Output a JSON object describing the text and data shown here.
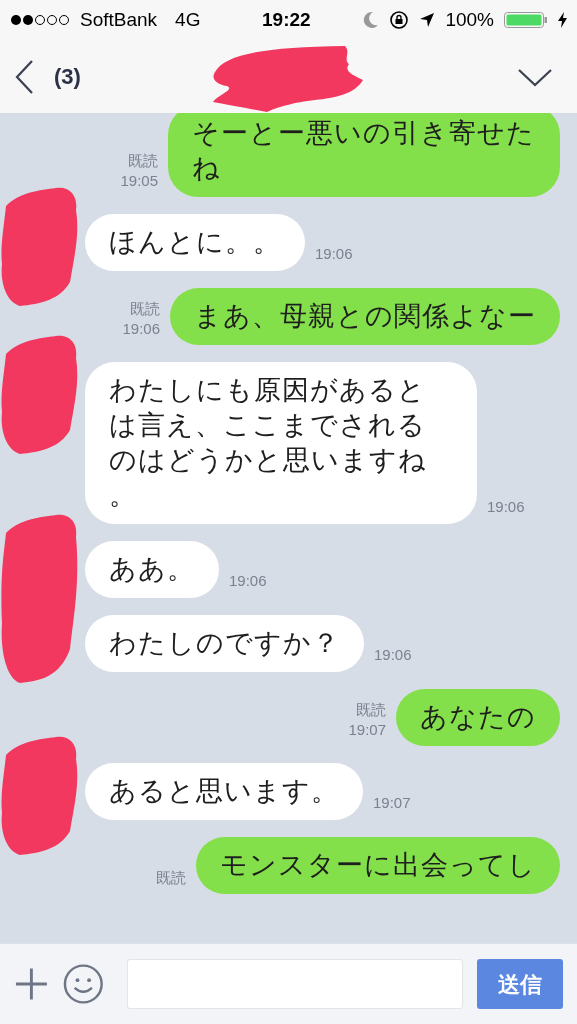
{
  "status_bar": {
    "carrier": "SoftBank",
    "network": "4G",
    "time": "19:22",
    "battery_percent": "100%"
  },
  "header": {
    "unread_count": "(3)"
  },
  "messages": [
    {
      "kind": "sent",
      "text": "そーとー悪いの引き寄せたね",
      "read": "既読",
      "time": "19:05"
    },
    {
      "kind": "received",
      "text": "ほんとに。。",
      "time": "19:06",
      "show_avatar": true
    },
    {
      "kind": "sent",
      "text": "まあ、母親との関係よなー",
      "read": "既読",
      "time": "19:06"
    },
    {
      "kind": "received",
      "text": "わたしにも原因があるとは言え、ここまでされるのはどうかと思いますね。",
      "time": "19:06",
      "show_avatar": true
    },
    {
      "kind": "received",
      "text": "ああ。",
      "time": "19:06",
      "show_avatar": true
    },
    {
      "kind": "received",
      "text": "わたしのですか？",
      "time": "19:06",
      "show_avatar": false
    },
    {
      "kind": "sent",
      "text": "あなたの",
      "read": "既読",
      "time": "19:07"
    },
    {
      "kind": "received",
      "text": "あると思います。",
      "time": "19:07",
      "show_avatar": true
    },
    {
      "kind": "sent",
      "text": "モンスターに出会ってし",
      "read": "既読"
    }
  ],
  "input_bar": {
    "send_button": "送信"
  }
}
